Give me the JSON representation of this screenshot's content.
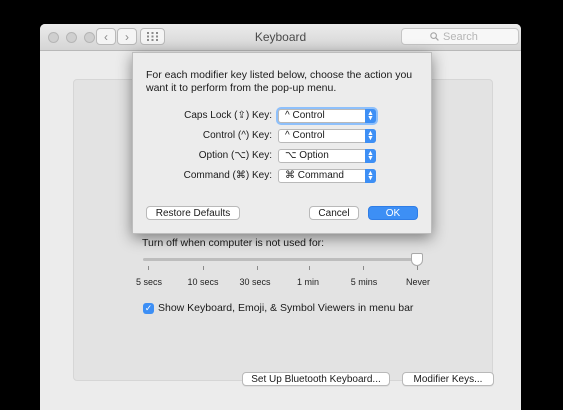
{
  "window": {
    "title": "Keyboard",
    "search_placeholder": "Search",
    "back_icon": "chevron-left-icon",
    "forward_icon": "chevron-right-icon"
  },
  "panel": {
    "sleep_label": "Turn off when computer is not used for:",
    "slider": {
      "ticks": [
        "5 secs",
        "10 secs",
        "30 secs",
        "1 min",
        "5 mins",
        "Never"
      ],
      "selected": "Never"
    },
    "show_viewers_label": "Show Keyboard, Emoji, & Symbol Viewers in menu bar",
    "show_viewers_checked": true,
    "bluetooth_button": "Set Up Bluetooth Keyboard...",
    "modifier_button": "Modifier Keys..."
  },
  "sheet": {
    "intro": "For each modifier key listed below, choose the action you want it to perform from the pop-up menu.",
    "rows": [
      {
        "label": "Caps Lock (⇪) Key:",
        "value": "^ Control"
      },
      {
        "label": "Control (^) Key:",
        "value": "^ Control"
      },
      {
        "label": "Option (⌥) Key:",
        "value": "⌥ Option"
      },
      {
        "label": "Command (⌘) Key:",
        "value": "⌘ Command"
      }
    ],
    "restore_button": "Restore Defaults",
    "cancel_button": "Cancel",
    "ok_button": "OK"
  },
  "colors": {
    "accent": "#3d8ff5",
    "window_bg": "#ececec"
  }
}
